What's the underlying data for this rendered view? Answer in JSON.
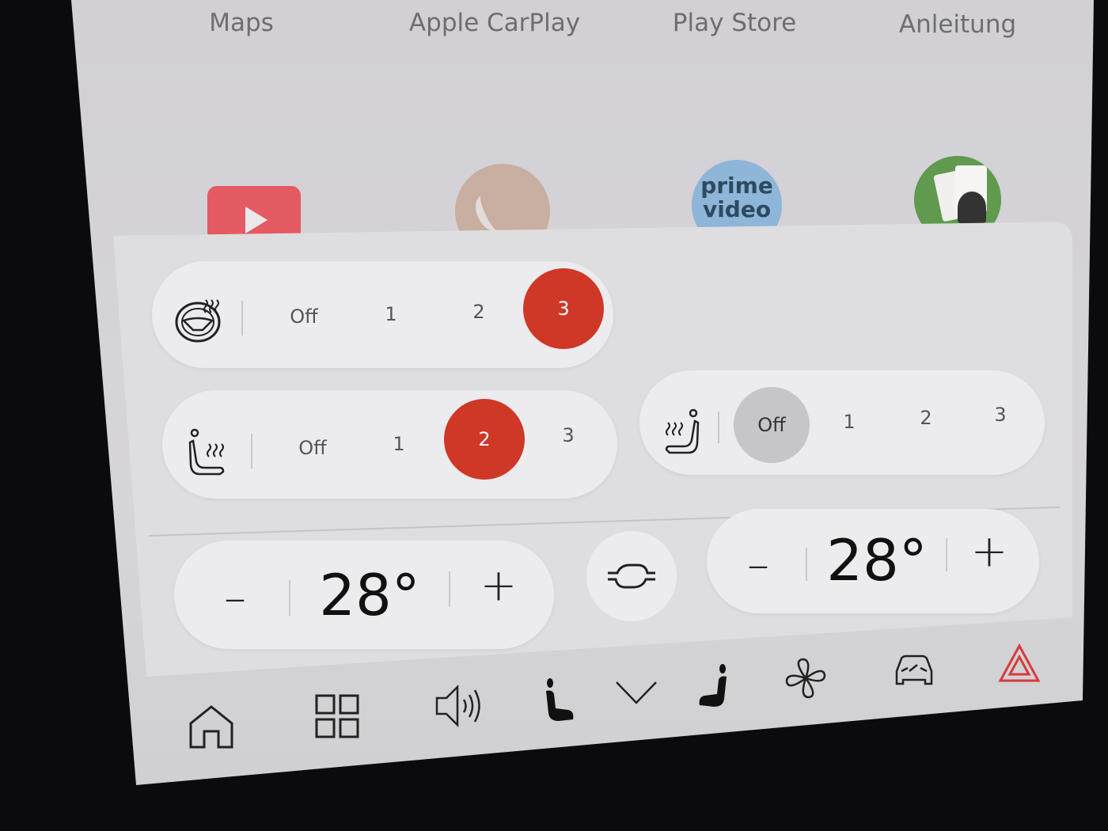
{
  "top_apps": {
    "labels": [
      "Maps",
      "Apple CarPlay",
      "Play Store",
      "Anleitung"
    ],
    "partial_icons": [
      "youtube-icon",
      "phone-icon",
      "prime-video-icon",
      "solitaire-icon"
    ],
    "prime_text": [
      "prime",
      "video"
    ]
  },
  "climate": {
    "steering_heat": {
      "icon": "steering-wheel-heat-icon",
      "options": [
        "Off",
        "1",
        "2",
        "3"
      ],
      "selected": "3"
    },
    "driver_seat_heat": {
      "icon": "seat-heat-left-icon",
      "options": [
        "Off",
        "1",
        "2",
        "3"
      ],
      "selected": "2"
    },
    "passenger_seat_heat": {
      "icon": "seat-heat-right-icon",
      "options": [
        "Off",
        "1",
        "2",
        "3"
      ],
      "selected": "Off"
    },
    "left_temp": {
      "value": "28°",
      "minus": "–",
      "plus": "+"
    },
    "sync_icon": "sync-temperature-icon",
    "right_temp": {
      "value": "28°",
      "minus": "–",
      "plus": "+"
    },
    "accent_color": "#cf3727"
  },
  "bottom_bar": {
    "icons": [
      "home-icon",
      "apps-grid-icon",
      "volume-icon",
      "driver-seat-icon",
      "chevron-down-icon",
      "passenger-seat-icon",
      "fan-icon",
      "car-icon",
      "hazard-icon"
    ]
  }
}
